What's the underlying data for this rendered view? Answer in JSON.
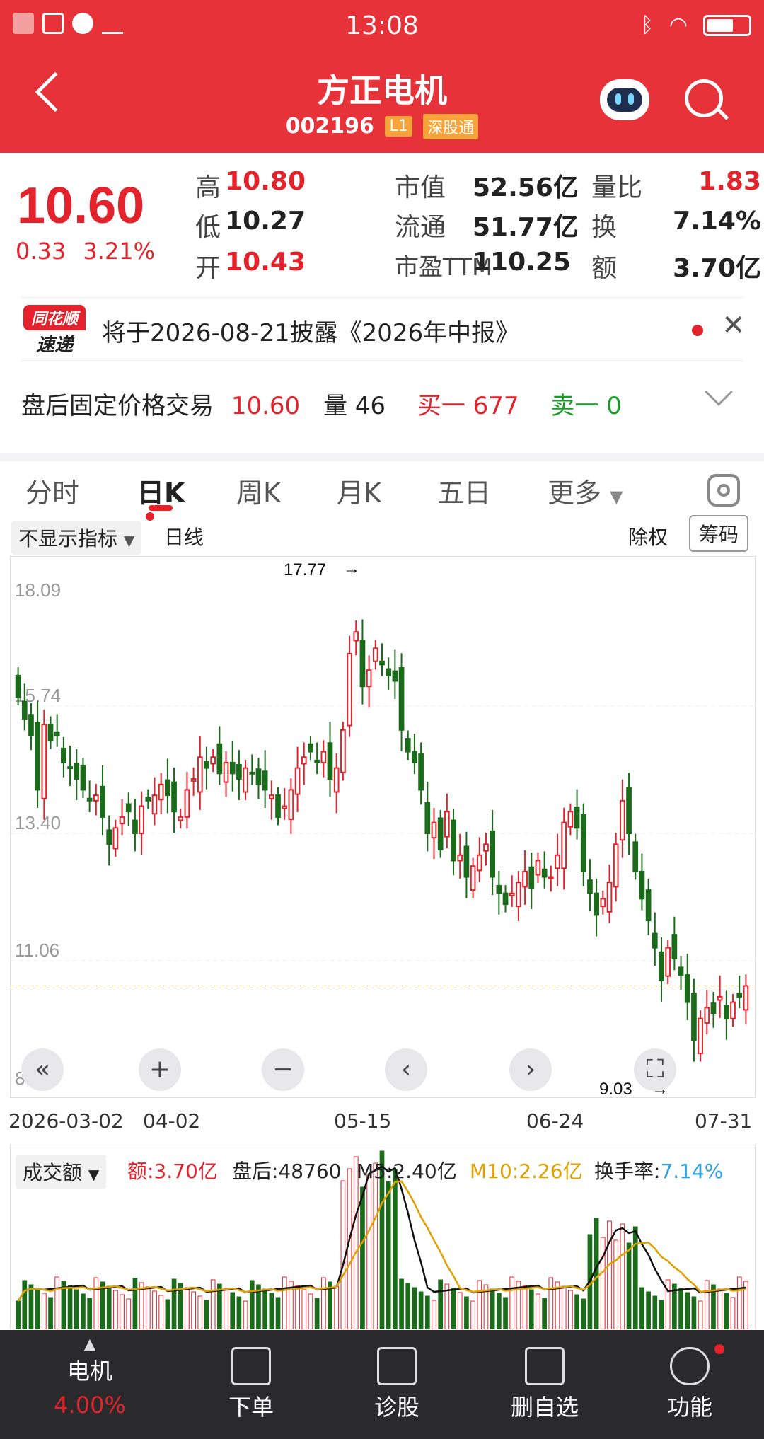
{
  "status_bar": {
    "time": "13:08"
  },
  "header": {
    "title": "方正电机",
    "code": "002196",
    "tags": [
      "L1",
      "深股通"
    ]
  },
  "quote": {
    "price": "10.60",
    "change": "0.33",
    "change_pct": "3.21%",
    "rows": [
      [
        {
          "label": "高",
          "value": "10.80"
        },
        {
          "label": "市值",
          "value": "52.56亿"
        },
        {
          "label": "量比",
          "value": "1.83"
        }
      ],
      [
        {
          "label": "低",
          "value": "10.27"
        },
        {
          "label": "流通",
          "value": "51.77亿"
        },
        {
          "label": "换",
          "value": "7.14%"
        }
      ],
      [
        {
          "label": "开",
          "value": "10.43"
        },
        {
          "label": "市盈TTM",
          "value": "110.25"
        },
        {
          "label": "额",
          "value": "3.70亿"
        }
      ]
    ]
  },
  "notice": {
    "logo_top": "同花顺",
    "logo_bottom": "速递",
    "text": "将于2026-08-21披露《2026年中报》"
  },
  "after_hours": {
    "label": "盘后固定价格交易",
    "price": "10.60",
    "vol_label": "量",
    "vol": "46",
    "buy_label": "买一",
    "buy": "677",
    "sell_label": "卖一",
    "sell": "0"
  },
  "tabs": [
    "分时",
    "日K",
    "周K",
    "月K",
    "五日",
    "更多"
  ],
  "active_tab": "日K",
  "chart_toolbar": {
    "indicator": "不显示指标",
    "line_type": "日线",
    "adjust": "除权",
    "chips": "筹码"
  },
  "chart_data": {
    "type": "candlestick",
    "y_ticks": [
      "18.09",
      "15.74",
      "13.40",
      "11.06",
      "8.71"
    ],
    "ylim": [
      8.71,
      18.09
    ],
    "x_ticks": [
      "2026-03-02",
      "04-02",
      "05-15",
      "06-24",
      "07-31"
    ],
    "max_label": "17.77",
    "min_label": "9.03",
    "current_line": 10.6,
    "closes": [
      15.9,
      15.5,
      15.2,
      14.2,
      15.4,
      15.1,
      15.2,
      14.7,
      14.6,
      14.4,
      14.2,
      14.0,
      14.1,
      13.7,
      13.2,
      13.5,
      13.7,
      13.8,
      13.4,
      13.9,
      14.0,
      14.1,
      14.3,
      14.1,
      13.8,
      13.7,
      14.2,
      14.4,
      14.8,
      14.6,
      14.8,
      14.5,
      14.7,
      14.5,
      14.4,
      14.6,
      14.5,
      14.3,
      14.2,
      14.1,
      13.7,
      13.9,
      14.2,
      14.6,
      14.8,
      14.9,
      14.7,
      14.9,
      14.4,
      14.6,
      15.3,
      16.7,
      17.1,
      16.1,
      16.4,
      16.8,
      16.5,
      16.3,
      16.2,
      15.3,
      14.9,
      14.7,
      14.2,
      13.4,
      13.6,
      13.1,
      13.8,
      12.9,
      13.0,
      12.6,
      12.8,
      13.0,
      13.2,
      12.6,
      12.3,
      12.1,
      12.3,
      12.5,
      12.7,
      12.4,
      12.9,
      12.6,
      12.6,
      13.0,
      13.6,
      13.8,
      13.5,
      12.7,
      12.3,
      11.9,
      12.2,
      12.5,
      13.2,
      14.0,
      13.4,
      12.7,
      12.2,
      11.8,
      11.3,
      10.7,
      11.3,
      11.1,
      10.8,
      10.3,
      9.6,
      10.0,
      10.2,
      10.1,
      10.4,
      10.0,
      10.3,
      10.4,
      10.6
    ],
    "volume_legend": {
      "label": "成交额",
      "amount": "额:3.70亿",
      "after": "盘后:48760",
      "m5": "M5:2.40亿",
      "m10": "M10:2.26亿",
      "turnover_label": "换手率:",
      "turnover": "7.14%"
    }
  },
  "bottom_nav": [
    {
      "label": "电机",
      "sub": "4.00%"
    },
    {
      "label": "下单"
    },
    {
      "label": "诊股"
    },
    {
      "label": "删自选"
    },
    {
      "label": "功能"
    }
  ],
  "colors": {
    "up": "#e3222b",
    "down": "#1a6b1a",
    "header": "#e8323a",
    "nav": "#2a2a2c"
  }
}
